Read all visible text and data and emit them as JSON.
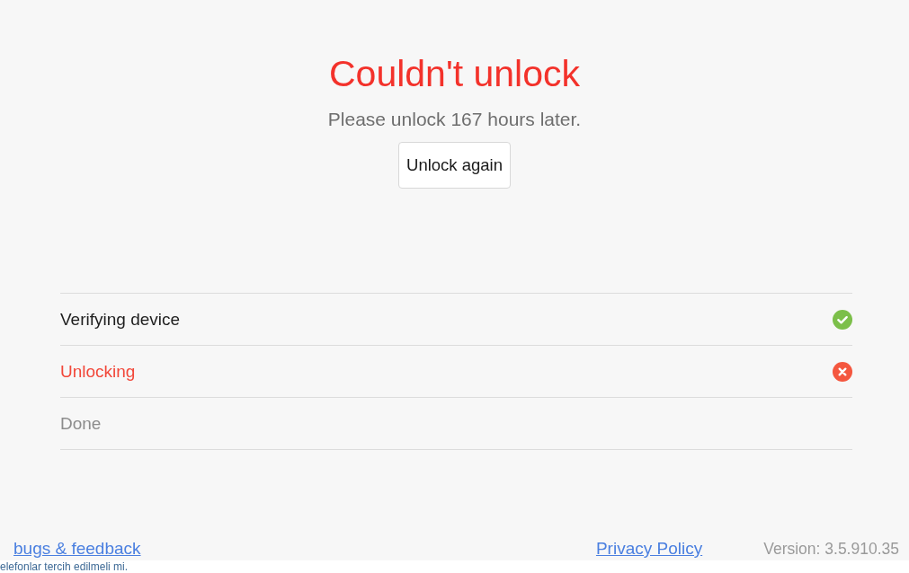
{
  "title": "Couldn't unlock",
  "message": "Please unlock 167 hours later.",
  "retry_button": "Unlock again",
  "steps": [
    {
      "label": "Verifying device",
      "completed": true,
      "failed": false
    },
    {
      "label": "Unlocking",
      "completed": false,
      "failed": true
    },
    {
      "label": "Done",
      "completed": false,
      "failed": false
    }
  ],
  "footer": {
    "feedback_link": "bugs & feedback",
    "privacy_link": "Privacy Policy",
    "version": "Version: 3.5.910.35"
  },
  "background_text": "elefonlar tercih edilmeli mi."
}
